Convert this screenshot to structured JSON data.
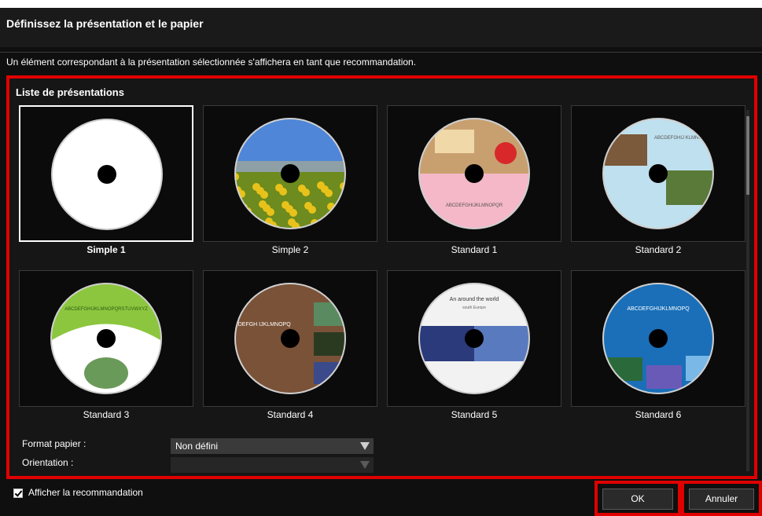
{
  "dialog": {
    "title": "Définissez la présentation et le papier",
    "description": "Un élément correspondant à la présentation sélectionnée s'affichera en tant que recommandation."
  },
  "layouts": {
    "heading": "Liste de présentations",
    "selected": "Simple 1",
    "items": [
      {
        "label": "Simple 1",
        "style": "plain-white"
      },
      {
        "label": "Simple 2",
        "style": "sunflower-photo"
      },
      {
        "label": "Standard 1",
        "style": "food-photo-pink-check",
        "text": "ABCDEFGHIJKLMNOPQR"
      },
      {
        "label": "Standard 2",
        "style": "family-photos-blue-check",
        "text": "ABCDEFGHIJ KLMNOPQR"
      },
      {
        "label": "Standard 3",
        "style": "green-arc-plant",
        "text": "ABCDEFGHIJKLMNOPQRSTUVWXYZ"
      },
      {
        "label": "Standard 4",
        "style": "brown-grid-photos",
        "text": "ABCDEFGH IJKLMNOPQ"
      },
      {
        "label": "Standard 5",
        "style": "city-night-travel",
        "text": "An around the world",
        "subtext": "south Europe"
      },
      {
        "label": "Standard 6",
        "style": "blue-abstract",
        "text": "ABCDEFGHIJKLMNOPQ"
      }
    ]
  },
  "form": {
    "paper_label": "Format papier :",
    "paper_value": "Non défini",
    "orientation_label": "Orientation :",
    "orientation_value": ""
  },
  "footer": {
    "recommend_label": "Afficher la recommandation",
    "recommend_checked": true,
    "ok_label": "OK",
    "cancel_label": "Annuler"
  },
  "colors": {
    "highlight": "#e00000",
    "background": "#0f0f0f"
  }
}
